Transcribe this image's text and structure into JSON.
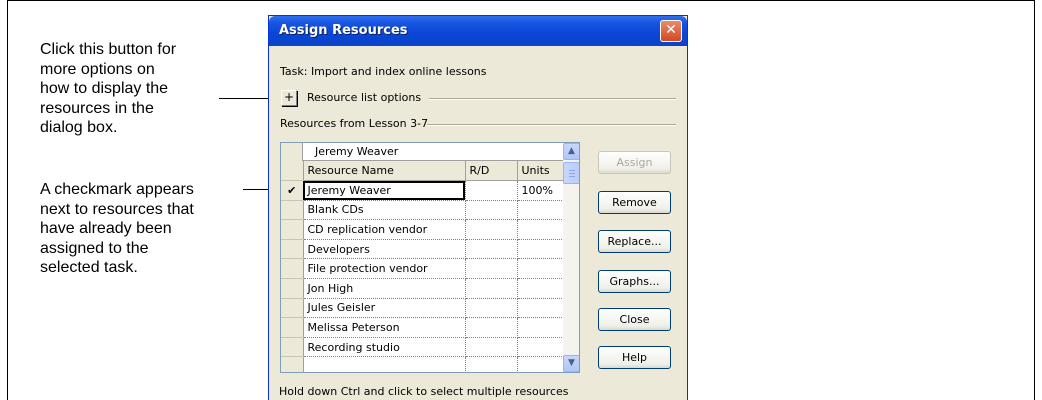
{
  "callouts": {
    "first": [
      "Click this button for",
      "more options on",
      "how to display the",
      "resources in the",
      "dialog box."
    ],
    "second": [
      "A checkmark appears",
      "next to resources that",
      "have already been",
      "assigned to the",
      "selected task."
    ]
  },
  "dialog": {
    "title": "Assign Resources",
    "close_glyph": "✕",
    "task_label": "Task: Import and index online lessons",
    "options_toggle": "+",
    "options_label": "Resource list options",
    "resources_from": "Resources from Lesson 3-7",
    "edit_value": "Jeremy Weaver",
    "columns": [
      "Resource Name",
      "R/D",
      "Units"
    ],
    "rows": [
      {
        "check": "✔",
        "name": "Jeremy Weaver",
        "rd": "",
        "units": "100%"
      },
      {
        "check": "",
        "name": "Blank CDs",
        "rd": "",
        "units": ""
      },
      {
        "check": "",
        "name": "CD replication vendor",
        "rd": "",
        "units": ""
      },
      {
        "check": "",
        "name": "Developers",
        "rd": "",
        "units": ""
      },
      {
        "check": "",
        "name": "File protection vendor",
        "rd": "",
        "units": ""
      },
      {
        "check": "",
        "name": "Jon High",
        "rd": "",
        "units": ""
      },
      {
        "check": "",
        "name": "Jules Geisler",
        "rd": "",
        "units": ""
      },
      {
        "check": "",
        "name": "Melissa Peterson",
        "rd": "",
        "units": ""
      },
      {
        "check": "",
        "name": "Recording studio",
        "rd": "",
        "units": ""
      },
      {
        "check": "",
        "name": "",
        "rd": "",
        "units": ""
      }
    ],
    "buttons": {
      "assign": "Assign",
      "remove": "Remove",
      "replace": "Replace...",
      "graphs": "Graphs...",
      "close": "Close",
      "help": "Help"
    },
    "status_text": "Hold down Ctrl and click to select multiple resources"
  }
}
